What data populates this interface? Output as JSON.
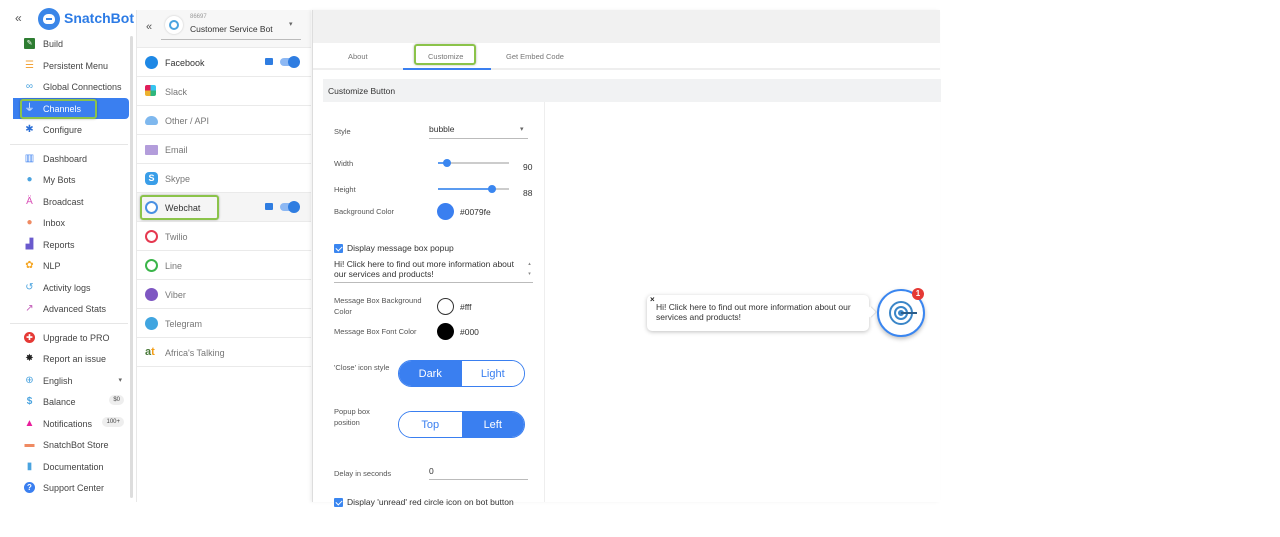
{
  "app": {
    "name": "SnatchBot",
    "collapse_icon": "«"
  },
  "sidebar": {
    "items": [
      {
        "label": "Build",
        "icon": "build-icon",
        "glyph": "■",
        "color": "#2e7d32"
      },
      {
        "label": "Persistent Menu",
        "icon": "menu-icon",
        "glyph": "☰",
        "color": "#f2a33a"
      },
      {
        "label": "Global Connections",
        "icon": "link-icon",
        "glyph": "∞",
        "color": "#4aa3df"
      },
      {
        "label": "Channels",
        "icon": "plug-icon",
        "glyph": "⏚",
        "color": "#ffffff",
        "active": true
      },
      {
        "label": "Configure",
        "icon": "gear-icon",
        "glyph": "✱",
        "color": "#2c6fd6"
      },
      {
        "label": "Dashboard",
        "icon": "dashboard-icon",
        "glyph": "▥",
        "color": "#3a7ff0"
      },
      {
        "label": "My Bots",
        "icon": "robot-icon",
        "glyph": "●",
        "color": "#4aa3df"
      },
      {
        "label": "Broadcast",
        "icon": "broadcast-icon",
        "glyph": "Ä",
        "color": "#d94fb6"
      },
      {
        "label": "Inbox",
        "icon": "chat-icon",
        "glyph": "●",
        "color": "#ef8a62"
      },
      {
        "label": "Reports",
        "icon": "reports-icon",
        "glyph": "▟",
        "color": "#6a5acd"
      },
      {
        "label": "NLP",
        "icon": "nlp-icon",
        "glyph": "✿",
        "color": "#f5a623"
      },
      {
        "label": "Activity logs",
        "icon": "history-icon",
        "glyph": "↺",
        "color": "#4aa3df"
      },
      {
        "label": "Advanced Stats",
        "icon": "stats-icon",
        "glyph": "↗",
        "color": "#c156b5"
      },
      {
        "label": "Upgrade to PRO",
        "icon": "upgrade-icon",
        "glyph": "✚",
        "color": "#e53935"
      },
      {
        "label": "Report an issue",
        "icon": "bug-icon",
        "glyph": "✸",
        "color": "#222222"
      },
      {
        "label": "English",
        "icon": "globe-icon",
        "glyph": "⊕",
        "color": "#4aa3df",
        "caret": "▾"
      },
      {
        "label": "Balance",
        "icon": "dollar-icon",
        "glyph": "$",
        "color": "#4aa3df",
        "badge": "$0"
      },
      {
        "label": "Notifications",
        "icon": "bell-icon",
        "glyph": "▲",
        "color": "#e91e9c",
        "badge": "100+"
      },
      {
        "label": "SnatchBot Store",
        "icon": "store-icon",
        "glyph": "▬",
        "color": "#ef8a62"
      },
      {
        "label": "Documentation",
        "icon": "document-icon",
        "glyph": "▮",
        "color": "#4aa3df"
      },
      {
        "label": "Support Center",
        "icon": "help-icon",
        "glyph": "?",
        "color": "#3a7ff0"
      }
    ]
  },
  "bot": {
    "back_icon": "«",
    "id": "86697",
    "name": "Customer Service Bot",
    "dropdown_icon": "▾"
  },
  "channels": [
    {
      "label": "Facebook",
      "icon": "facebook-messenger-icon",
      "color": "#1e88e5",
      "enabled": true
    },
    {
      "label": "Slack",
      "icon": "slack-icon",
      "color": "#e01e5a",
      "enabled": false
    },
    {
      "label": "Other / API",
      "icon": "cloud-icon",
      "color": "#7fb8ee",
      "enabled": false
    },
    {
      "label": "Email",
      "icon": "email-icon",
      "color": "#b39ddb",
      "enabled": false
    },
    {
      "label": "Skype",
      "icon": "skype-icon",
      "color": "#3a9ee8",
      "enabled": false
    },
    {
      "label": "Webchat",
      "icon": "webchat-icon",
      "color": "#4a90e2",
      "enabled": true,
      "selected": true
    },
    {
      "label": "Twilio",
      "icon": "twilio-icon",
      "color": "#e53950",
      "enabled": false
    },
    {
      "label": "Line",
      "icon": "line-icon",
      "color": "#3bb54a",
      "enabled": false
    },
    {
      "label": "Viber",
      "icon": "viber-icon",
      "color": "#7e57c2",
      "enabled": false
    },
    {
      "label": "Telegram",
      "icon": "telegram-icon",
      "color": "#40a5e0",
      "enabled": false
    },
    {
      "label": "Africa's Talking",
      "icon": "africas-talking-icon",
      "color": "#f39c12",
      "enabled": false
    }
  ],
  "tabs": [
    {
      "label": "About"
    },
    {
      "label": "Customize",
      "active": true
    },
    {
      "label": "Get Embed Code"
    }
  ],
  "section": {
    "title": "Customize Button"
  },
  "form": {
    "style": {
      "label": "Style",
      "value": "bubble",
      "dropdown_icon": "▾"
    },
    "width": {
      "label": "Width",
      "value": "90",
      "fraction": 0.12
    },
    "height": {
      "label": "Height",
      "value": "88",
      "fraction": 0.76
    },
    "background_color": {
      "label": "Background Color",
      "value": "#0079fe",
      "swatch": "#3a7ff0"
    },
    "display_popup": {
      "label": "Display message box popup",
      "checked": true
    },
    "popup_message": "Hi! Click here to find out more information about our services and products!",
    "msg_bg_color": {
      "label": "Message Box Background Color",
      "value": "#fff"
    },
    "msg_font_color": {
      "label": "Message Box Font Color",
      "value": "#000"
    },
    "close_icon_style": {
      "label": "'Close' icon style",
      "options": [
        "Dark",
        "Light"
      ],
      "selected": "Dark"
    },
    "popup_position": {
      "label": "Popup box position",
      "options": [
        "Top",
        "Left"
      ],
      "selected": "Left"
    },
    "delay": {
      "label": "Delay in seconds",
      "value": "0"
    },
    "display_unread": {
      "label": "Display 'unread' red circle icon on bot button",
      "checked": true
    }
  },
  "preview": {
    "close_glyph": "×",
    "message": "Hi! Click here to find out more information about our services and products!",
    "unread_count": "1"
  },
  "colors": {
    "accent": "#3a7ff0",
    "highlight": "#8bc34a",
    "unread": "#e53935"
  }
}
